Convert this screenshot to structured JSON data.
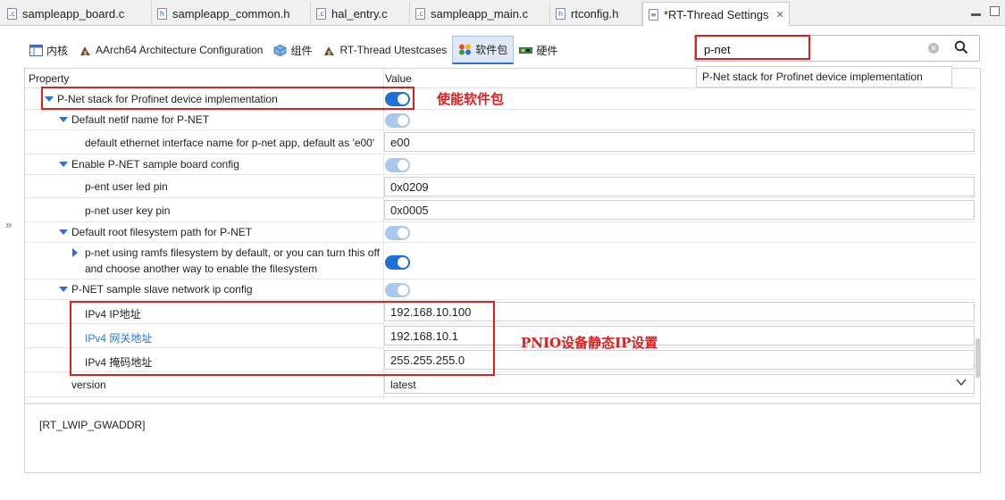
{
  "editor_tabs": [
    {
      "label": "sampleapp_board.c",
      "icon": "c-file-icon",
      "active": false
    },
    {
      "label": "sampleapp_common.h",
      "icon": "h-file-icon",
      "active": false
    },
    {
      "label": "hal_entry.c",
      "icon": "c-file-icon",
      "active": false
    },
    {
      "label": "sampleapp_main.c",
      "icon": "c-file-icon",
      "active": false
    },
    {
      "label": "rtconfig.h",
      "icon": "h-file-icon",
      "active": false
    },
    {
      "label": "*RT-Thread Settings",
      "icon": "settings-icon",
      "active": true,
      "close": "✕"
    }
  ],
  "settings_tabs": [
    {
      "label": "内核",
      "icon": "kernel-icon"
    },
    {
      "label": "AArch64 Architecture Configuration",
      "icon": "arch-icon"
    },
    {
      "label": "组件",
      "icon": "component-icon"
    },
    {
      "label": "RT-Thread Utestcases",
      "icon": "testcase-icon"
    },
    {
      "label": "软件包",
      "icon": "package-icon",
      "active": true
    },
    {
      "label": "硬件",
      "icon": "hardware-icon"
    }
  ],
  "search": {
    "value": "p-net",
    "suggestion": "P-Net stack for Profinet device implementation"
  },
  "table": {
    "col_property": "Property",
    "col_value": "Value",
    "rows": [
      {
        "label": "P-Net stack for Profinet device implementation",
        "type": "toggle",
        "on": true,
        "enabled": true
      },
      {
        "label": "Default netif name for P-NET",
        "type": "toggle",
        "on": true,
        "enabled": false
      },
      {
        "label": "default ethernet interface name for p-net app, default as 'e00'",
        "type": "text",
        "value": "e00"
      },
      {
        "label": "Enable P-NET sample board config",
        "type": "toggle",
        "on": true,
        "enabled": false
      },
      {
        "label": "p-ent user led pin",
        "type": "text",
        "value": "0x0209"
      },
      {
        "label": "p-net user key pin",
        "type": "text",
        "value": "0x0005"
      },
      {
        "label": "Default root filesystem path for P-NET",
        "type": "toggle",
        "on": true,
        "enabled": false
      },
      {
        "label": "p-net using ramfs filesystem by default, or you can turn this off and choose another way to enable the filesystem",
        "type": "toggle",
        "on": true,
        "enabled": true
      },
      {
        "label": "P-NET sample slave network ip config",
        "type": "toggle",
        "on": true,
        "enabled": false
      },
      {
        "label": "IPv4 IP地址",
        "type": "text",
        "value": "192.168.10.100"
      },
      {
        "label": "IPv4 网关地址",
        "type": "text",
        "value": "192.168.10.1"
      },
      {
        "label": "IPv4 掩码地址",
        "type": "text",
        "value": "255.255.255.0"
      },
      {
        "label": "version",
        "type": "select",
        "value": "latest"
      }
    ]
  },
  "description": "[RT_LWIP_GWADDR]",
  "annotations": {
    "enable_package": "使能软件包",
    "pnio_static_ip": "PNIO设备静态IP设置"
  },
  "colors": {
    "accent": "#1f6fd6",
    "annotation": "#e11d1d",
    "link": "#2a7ad6"
  }
}
